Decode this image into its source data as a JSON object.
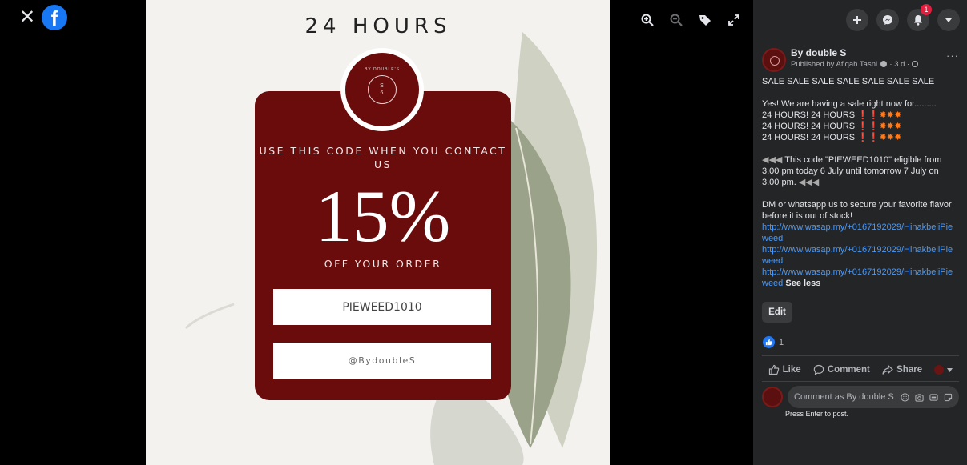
{
  "viewer": {
    "close_glyph": "✕",
    "logo_glyph": "f",
    "tools": [
      "zoom-in-icon",
      "zoom-out-icon",
      "tag-icon",
      "fullscreen-icon"
    ]
  },
  "poster": {
    "title": "24 HOURS",
    "badge_line1": "BY DOUBLE'S",
    "badge_line2": "S",
    "badge_line3": "6",
    "use_code": "USE THIS CODE WHEN YOU CONTACT US",
    "percent": "15%",
    "off": "OFF YOUR ORDER",
    "code": "PIEWEED1010",
    "handle": "@BydoubleS",
    "card_color": "#6a0c0c"
  },
  "panel": {
    "notification_count": "1",
    "page_name": "By double S",
    "published": "Published by Afiqah Tasni",
    "time": "· 3 d ·",
    "more": "···",
    "lines": {
      "l1": "SALE SALE SALE SALE SALE SALE SALE",
      "l2": "Yes! We are having a sale right now for.........",
      "l3": "24 HOURS! 24 HOURS",
      "l4": "24 HOURS! 24 HOURS",
      "l5": "24 HOURS! 24 HOURS",
      "l6": "This code \"PIEWEED1010\" eligible from 3.00 pm today 6 July until tomorrow 7 July on 3.00 pm.",
      "l7": "DM or whatsapp us to secure your favorite flavor before it is out of stock!",
      "link1": "http://www.wasap.my/+0167192029/HinakbeliPieweed",
      "link2": "http://www.wasap.my/+0167192029/HinakbeliPieweed",
      "link3": "http://www.wasap.my/+0167192029/HinakbeliPieweed",
      "see_less": "See less"
    },
    "edit_label": "Edit",
    "like_count": "1",
    "like_label": "Like",
    "comment_label": "Comment",
    "share_label": "Share",
    "comment_placeholder": "Comment as By double S",
    "press_enter": "Press Enter to post."
  }
}
